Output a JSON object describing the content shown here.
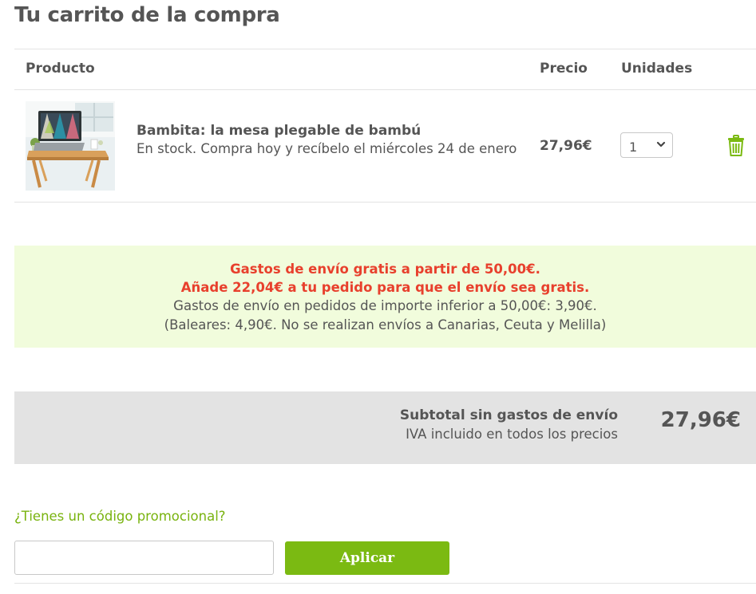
{
  "page": {
    "title": "Tu carrito de la compra"
  },
  "table": {
    "headers": {
      "product": "Producto",
      "price": "Precio",
      "units": "Unidades"
    }
  },
  "items": [
    {
      "name": "Bambita: la mesa plegable de bambú",
      "stock": "En stock. Compra hoy y recíbelo el miércoles 24 de enero",
      "price": "27,96€",
      "quantity": "1",
      "delete_icon": "trash-icon"
    }
  ],
  "shipping": {
    "line1": "Gastos de envío gratis a partir de 50,00€.",
    "line2": "Añade 22,04€ a tu pedido para que el envío sea gratis.",
    "line3": "Gastos de envío en pedidos de importe inferior a 50,00€: 3,90€.",
    "line4": "(Baleares: 4,90€. No se realizan envíos a Canarias, Ceuta y Melilla)"
  },
  "summary": {
    "subtotal_label": "Subtotal sin gastos de envío",
    "vat_note": "IVA incluido en todos los precios",
    "subtotal_value": "27,96€"
  },
  "promo": {
    "link": "¿Tienes un código promocional?",
    "input_value": "",
    "apply_label": "Aplicar"
  },
  "colors": {
    "accent_green": "#7bba12",
    "link_green": "#79b30f",
    "alert_red": "#e8402d",
    "shipping_bg": "#f1fcdc",
    "summary_bg": "#e3e3e3",
    "text": "#555555"
  }
}
